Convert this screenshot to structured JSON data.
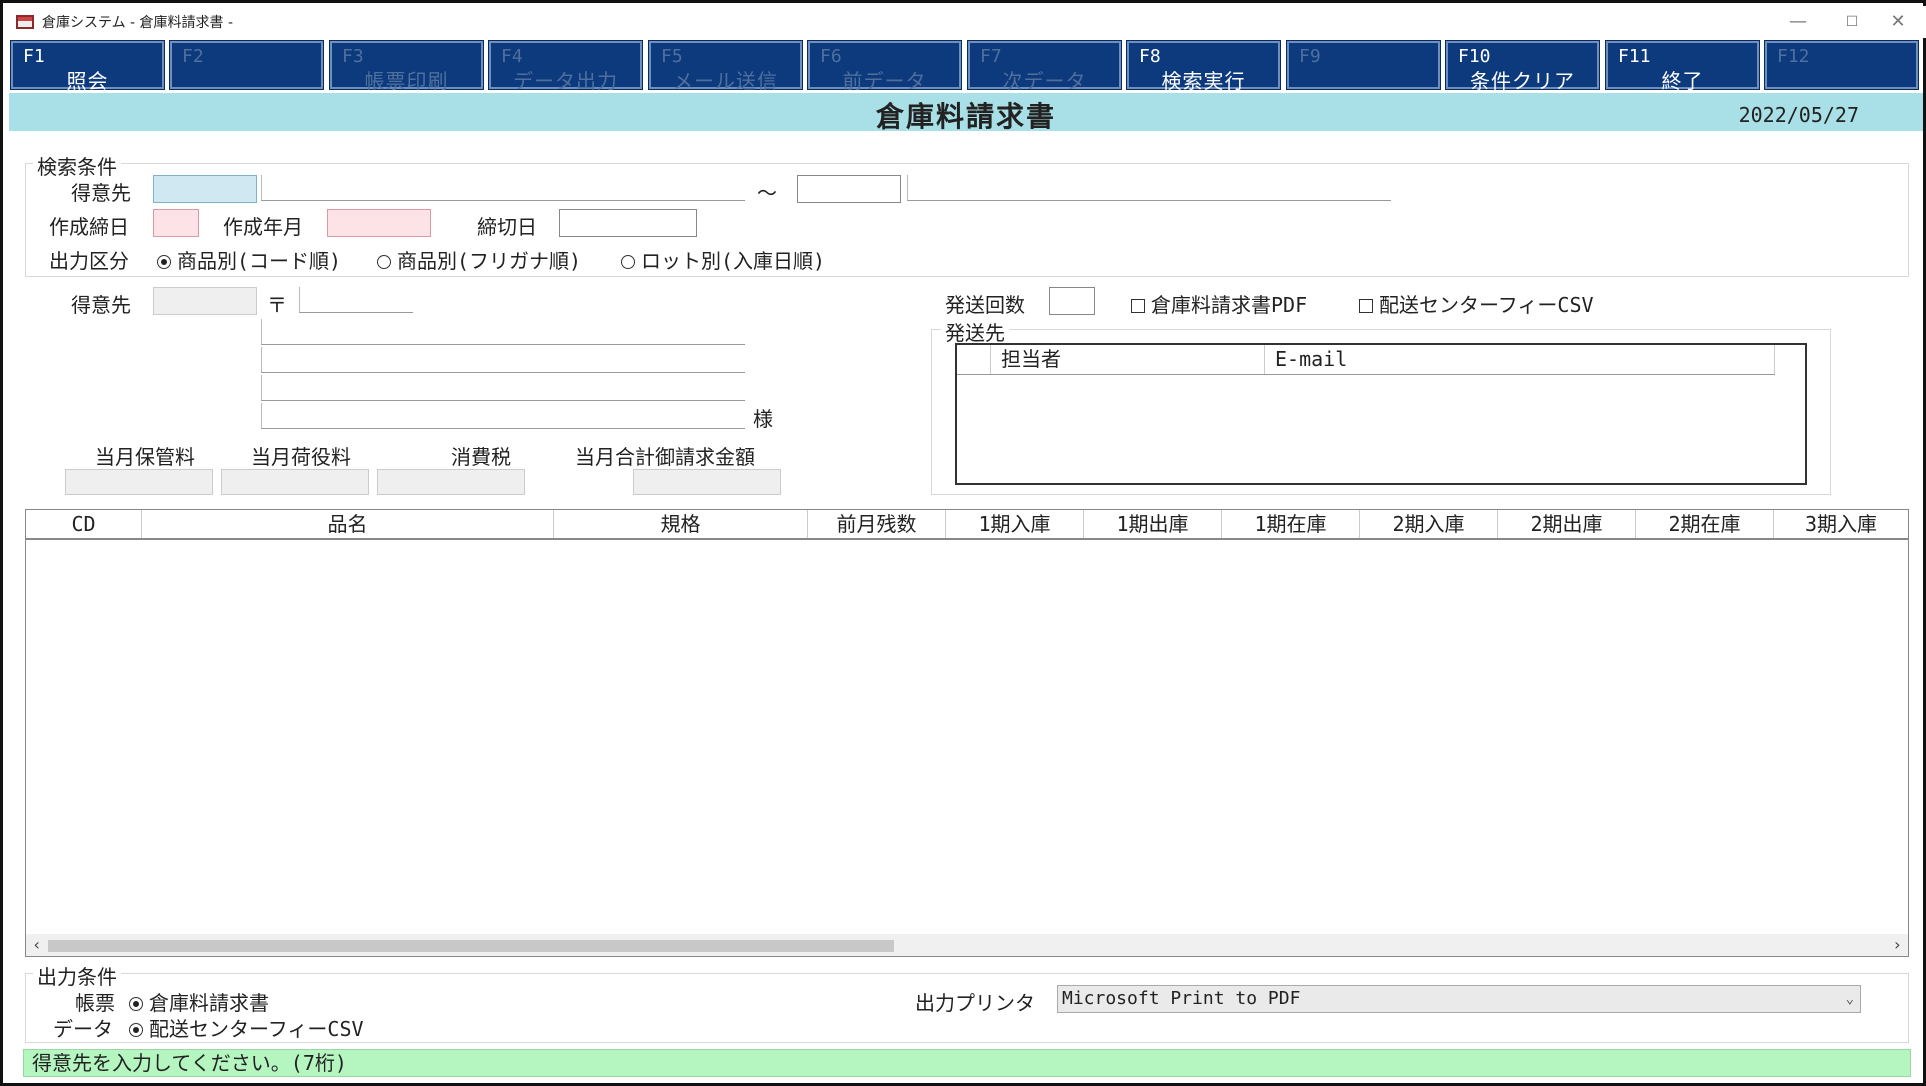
{
  "window": {
    "title": "倉庫システム - 倉庫料請求書 -",
    "minimize": "—",
    "maximize": "☐",
    "close": "✕"
  },
  "fkeys": [
    {
      "key": "F1",
      "label": "照会",
      "enabled": true
    },
    {
      "key": "F2",
      "label": "",
      "enabled": false
    },
    {
      "key": "F3",
      "label": "帳票印刷",
      "enabled": false
    },
    {
      "key": "F4",
      "label": "データ出力",
      "enabled": false
    },
    {
      "key": "F5",
      "label": "メール送信",
      "enabled": false
    },
    {
      "key": "F6",
      "label": "前データ",
      "enabled": false
    },
    {
      "key": "F7",
      "label": "次データ",
      "enabled": false
    },
    {
      "key": "F8",
      "label": "検索実行",
      "enabled": true
    },
    {
      "key": "F9",
      "label": "",
      "enabled": false
    },
    {
      "key": "F10",
      "label": "条件クリア",
      "enabled": true
    },
    {
      "key": "F11",
      "label": "終了",
      "enabled": true
    },
    {
      "key": "F12",
      "label": "",
      "enabled": false
    }
  ],
  "header": {
    "title": "倉庫料請求書",
    "date": "2022/05/27"
  },
  "search": {
    "group_label": "検索条件",
    "customer_label": "得意先",
    "tilde": "〜",
    "close_day_label": "作成締日",
    "year_month_label": "作成年月",
    "cutoff_label": "締切日",
    "output_kind_label": "出力区分",
    "options": [
      {
        "label": "商品別(コード順)",
        "selected": true
      },
      {
        "label": "商品別(フリガナ順)",
        "selected": false
      },
      {
        "label": "ロット別(入庫日順)",
        "selected": false
      }
    ]
  },
  "customer": {
    "label": "得意先",
    "postal_mark": "〒",
    "honorific": "様"
  },
  "totals": {
    "storage_fee": "当月保管料",
    "handling_fee": "当月荷役料",
    "tax": "消費税",
    "total": "当月合計御請求金額"
  },
  "send": {
    "count_label": "発送回数",
    "pdf_label": "倉庫料請求書PDF",
    "csv_label": "配送センターフィーCSV",
    "dest_label": "発送先",
    "col_person": "担当者",
    "col_email": "E-mail"
  },
  "grid": {
    "columns": [
      "CD",
      "品名",
      "規格",
      "前月残数",
      "1期入庫",
      "1期出庫",
      "1期在庫",
      "2期入庫",
      "2期出庫",
      "2期在庫",
      "3期入庫"
    ],
    "scroll_left": "‹",
    "scroll_right": "›"
  },
  "output": {
    "group_label": "出力条件",
    "report_label": "帳票",
    "report_value": "倉庫料請求書",
    "data_label": "データ",
    "data_value": "配送センターフィーCSV",
    "printer_label": "出力プリンタ",
    "printer_value": "Microsoft Print to PDF"
  },
  "status": {
    "message": "得意先を入力してください。(7桁)"
  }
}
